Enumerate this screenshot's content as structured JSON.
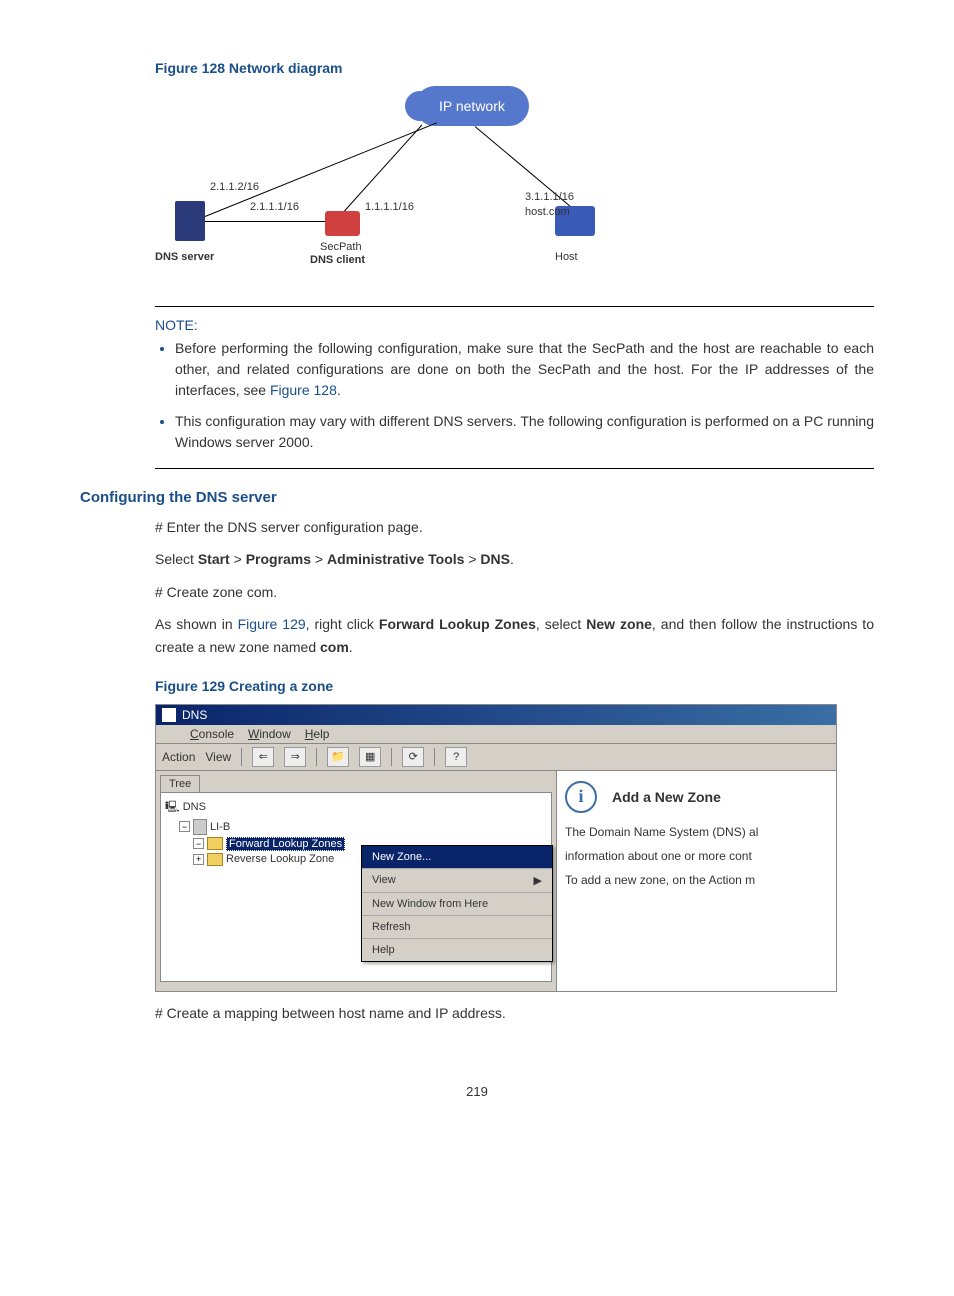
{
  "figure128": {
    "caption": "Figure 128 Network diagram",
    "cloud": "IP network",
    "dns_server_ip": "2.1.1.2/16",
    "secpath_left_ip": "2.1.1.1/16",
    "secpath_right_ip": "1.1.1.1/16",
    "host_ip": "3.1.1.1/16",
    "host_domain": "host.com",
    "dns_server_label": "DNS server",
    "secpath_label": "SecPath",
    "dns_client_label": "DNS client",
    "host_label": "Host"
  },
  "note": {
    "label": "NOTE:",
    "item1_a": "Before performing the following configuration, make sure that the SecPath and the host are reachable to each other, and related configurations are done on both the SecPath and the host. For the IP addresses of the interfaces, see ",
    "item1_link": "Figure 128",
    "item1_b": ".",
    "item2": "This configuration may vary with different DNS servers. The following configuration is performed on a PC running Windows server 2000."
  },
  "section": {
    "heading": "Configuring the DNS server",
    "p1": "# Enter the DNS server configuration page.",
    "p2_a": "Select ",
    "p2_start": "Start",
    "p2_gt": " > ",
    "p2_programs": "Programs",
    "p2_admin": "Administrative Tools",
    "p2_dns": "DNS",
    "p2_end": ".",
    "p3": "# Create zone com.",
    "p4_a": "As shown in ",
    "p4_link": "Figure 129",
    "p4_b": ", right click ",
    "p4_flz": "Forward Lookup Zones",
    "p4_c": ", select ",
    "p4_newzone": "New zone",
    "p4_d": ", and then follow the instructions to create a new zone named ",
    "p4_com": "com",
    "p4_e": "."
  },
  "figure129": {
    "caption": "Figure 129 Creating a zone"
  },
  "dns_window": {
    "title": "DNS",
    "menu": {
      "console": "Console",
      "window": "Window",
      "help": "Help"
    },
    "toolbar": {
      "action": "Action",
      "view": "View"
    },
    "tree": {
      "tab": "Tree",
      "root": "DNS",
      "server": "LI-B",
      "flz": "Forward Lookup Zones",
      "rlz": "Reverse Lookup Zone"
    },
    "context_menu": {
      "new_zone": "New Zone...",
      "view": "View",
      "new_window": "New Window from Here",
      "refresh": "Refresh",
      "help": "Help"
    },
    "right": {
      "title": "Add a New Zone",
      "text1": "The Domain Name System (DNS) al",
      "text2": "information about one or more cont",
      "text3": "To add a new zone, on the Action m"
    }
  },
  "p5": "# Create a mapping between host name and IP address.",
  "page_number": "219"
}
